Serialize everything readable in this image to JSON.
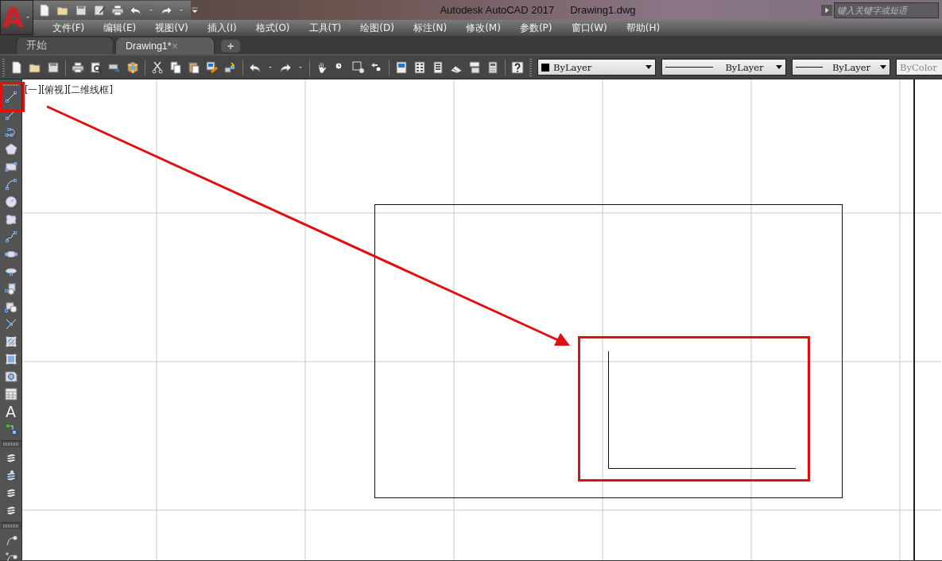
{
  "app_menu": {
    "logo": "A"
  },
  "title_bar": {
    "title": "Autodesk AutoCAD 2017",
    "document": "Drawing1.dwg",
    "search": {
      "placeholder": "键入关键字或短语"
    }
  },
  "menu": [
    "文件(F)",
    "编辑(E)",
    "视图(V)",
    "插入(I)",
    "格式(O)",
    "工具(T)",
    "绘图(D)",
    "标注(N)",
    "修改(M)",
    "参数(P)",
    "窗口(W)",
    "帮助(H)"
  ],
  "tabs": [
    {
      "label": "开始",
      "selected": false
    },
    {
      "label": "Drawing1*",
      "selected": true,
      "close": "×"
    }
  ],
  "new_tab": "+",
  "properties": [
    {
      "kind": "color",
      "value": "ByLayer",
      "disabled": false
    },
    {
      "kind": "linetype",
      "value": "ByLayer",
      "disabled": false
    },
    {
      "kind": "lineweight",
      "value": "ByLayer",
      "disabled": false
    },
    {
      "kind": "plotstyle",
      "value": "ByColor",
      "disabled": true
    }
  ],
  "draw_toolbar": {
    "text_tool": "A"
  },
  "viewport_label": "[一][俯视][二维线框]"
}
